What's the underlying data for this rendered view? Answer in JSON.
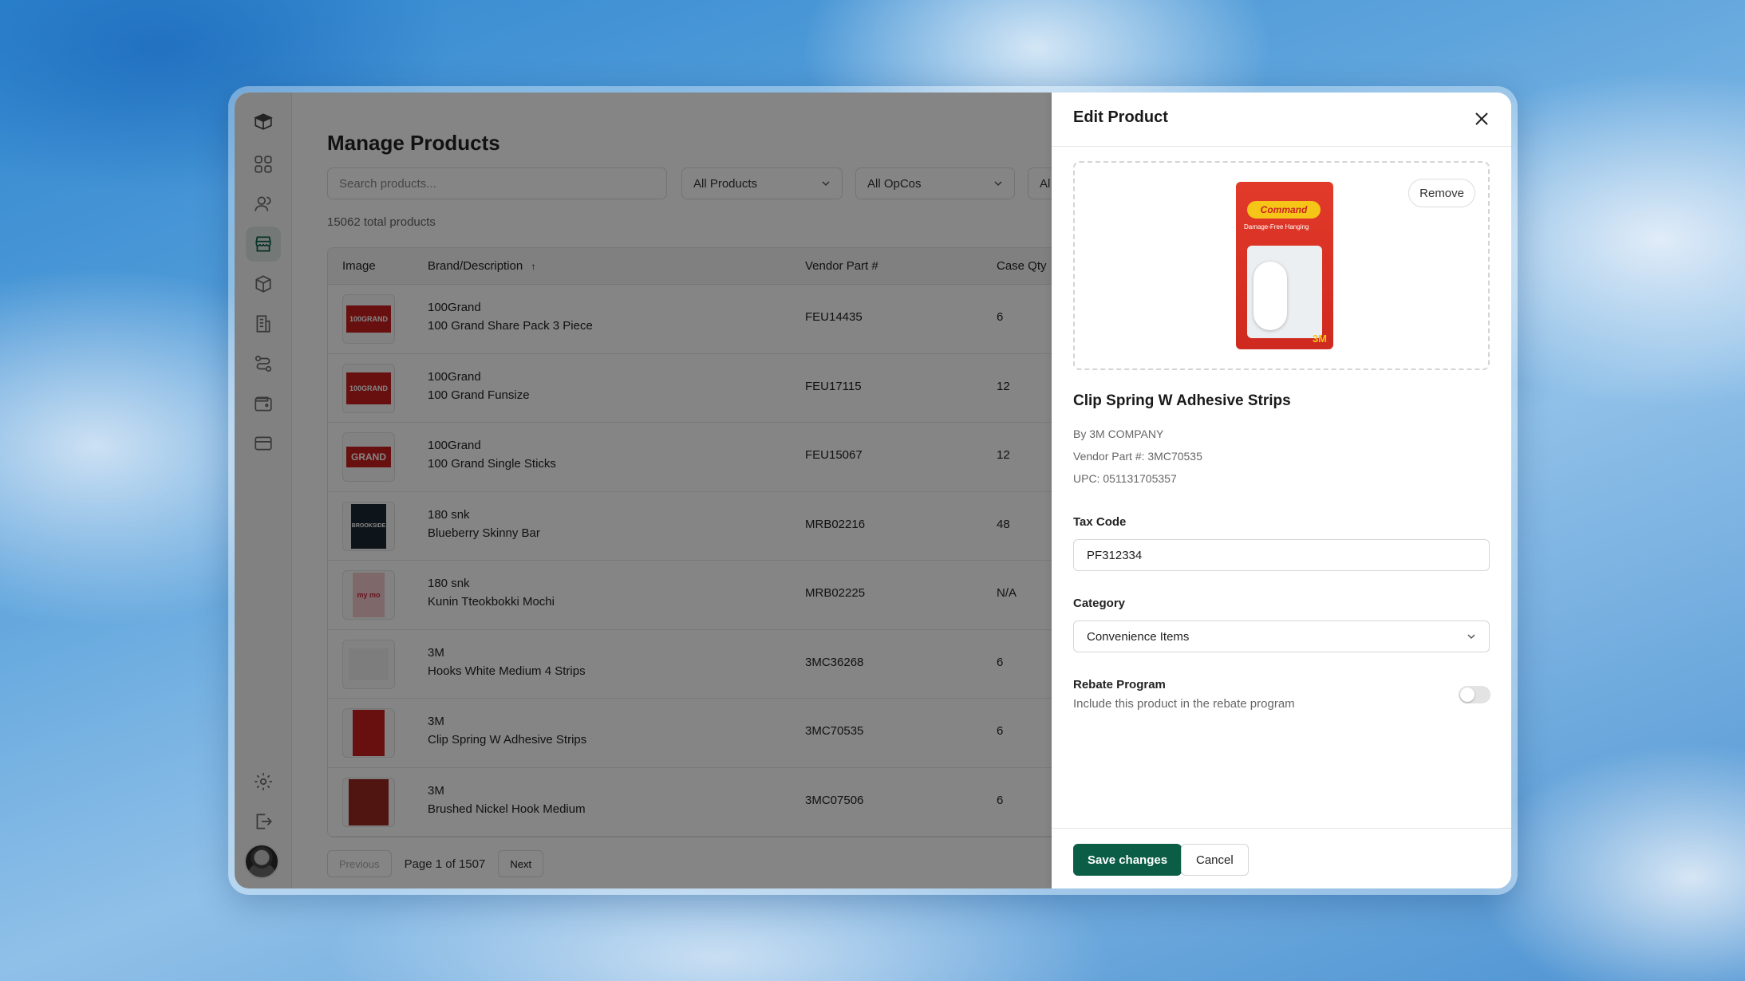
{
  "page": {
    "title": "Manage Products",
    "search_placeholder": "Search products...",
    "filters": [
      "All Products",
      "All OpCos",
      "Al"
    ],
    "total": "15062 total products"
  },
  "table": {
    "headers": {
      "image": "Image",
      "brand": "Brand/Description",
      "vendor": "Vendor Part #",
      "case_qty": "Case Qty"
    },
    "rows": [
      {
        "brand": "100Grand",
        "description": "100 Grand Share Pack 3 Piece",
        "vendor": "FEU14435",
        "case_qty": "6",
        "thumb_text": "100GRAND"
      },
      {
        "brand": "100Grand",
        "description": "100 Grand Funsize",
        "vendor": "FEU17115",
        "case_qty": "12",
        "thumb_text": "100GRAND"
      },
      {
        "brand": "100Grand",
        "description": "100 Grand Single Sticks",
        "vendor": "FEU15067",
        "case_qty": "12",
        "thumb_text": "GRAND"
      },
      {
        "brand": "180 snk",
        "description": "Blueberry Skinny Bar",
        "vendor": "MRB02216",
        "case_qty": "48",
        "thumb_text": "BROOKSIDE"
      },
      {
        "brand": "180 snk",
        "description": "Kunin Tteokbokki Mochi",
        "vendor": "MRB02225",
        "case_qty": "N/A",
        "thumb_text": "my mo"
      },
      {
        "brand": "3M",
        "description": "Hooks White Medium 4 Strips",
        "vendor": "3MC36268",
        "case_qty": "6",
        "thumb_text": ""
      },
      {
        "brand": "3M",
        "description": "Clip Spring W Adhesive Strips",
        "vendor": "3MC70535",
        "case_qty": "6",
        "thumb_text": ""
      },
      {
        "brand": "3M",
        "description": "Brushed Nickel Hook Medium",
        "vendor": "3MC07506",
        "case_qty": "6",
        "thumb_text": ""
      }
    ]
  },
  "pagination": {
    "previous": "Previous",
    "page_text": "Page 1 of 1507",
    "next": "Next"
  },
  "drawer": {
    "title": "Edit Product",
    "remove": "Remove",
    "product_name": "Clip Spring W Adhesive Strips",
    "by": "By 3M COMPANY",
    "vendor_part": "Vendor Part #: 3MC70535",
    "upc": "UPC: 051131705357",
    "tax_code_label": "Tax Code",
    "tax_code_value": "PF312334",
    "category_label": "Category",
    "category_value": "Convenience Items",
    "rebate_label": "Rebate Program",
    "rebate_sub": "Include this product in the rebate program",
    "rebate_enabled": false,
    "save": "Save changes",
    "cancel": "Cancel",
    "image_logo": "Command",
    "image_tag": "Damage-Free Hanging",
    "image_mark": "3M"
  },
  "colors": {
    "accent": "#0b5e45",
    "sidebar_active_bg": "#dfe9e4"
  },
  "sidebar": {
    "icons": [
      "box-logo-icon",
      "dashboard-grid-icon",
      "users-icon",
      "store-icon",
      "package-icon",
      "building-icon",
      "workflow-icon",
      "wallet-icon",
      "card-icon",
      "settings-icon",
      "logout-icon"
    ]
  }
}
